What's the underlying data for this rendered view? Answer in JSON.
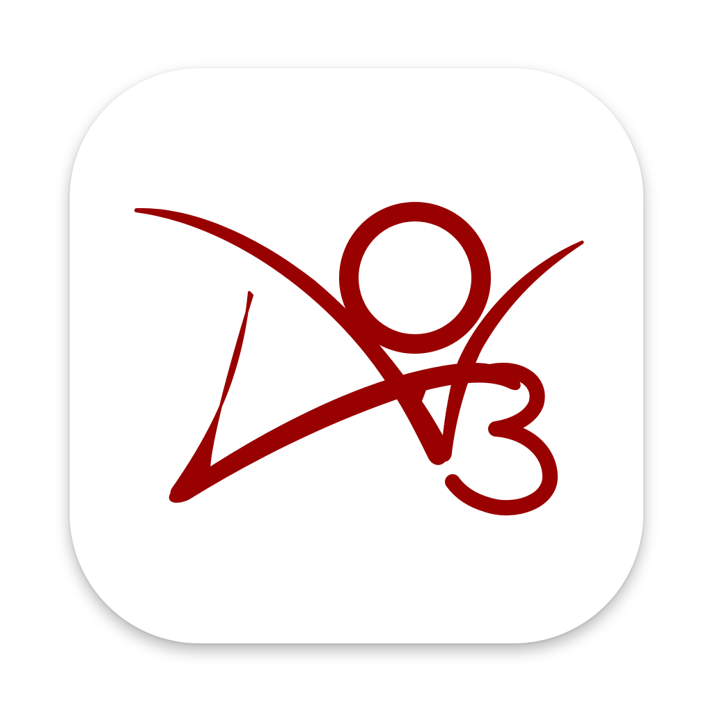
{
  "app_icon": {
    "name": "AO3",
    "logo_text": "AO3",
    "background_color": "#ffffff",
    "logo_color": "#990000",
    "icon": "ao3-logo-icon"
  }
}
